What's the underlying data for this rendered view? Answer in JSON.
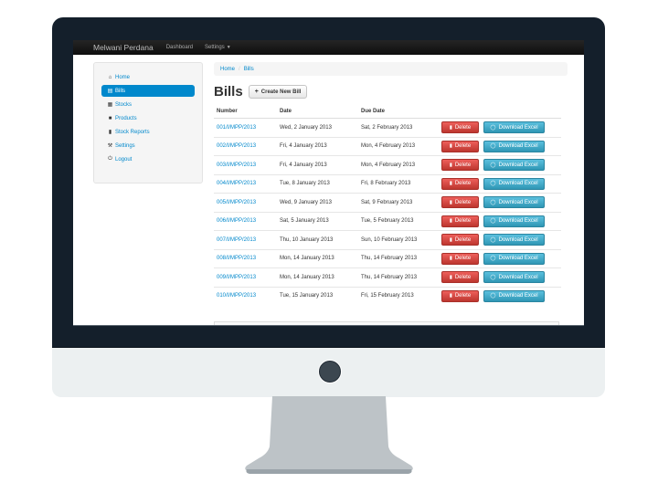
{
  "navbar": {
    "brand": "Melwani Perdana",
    "links": [
      {
        "label": "Dashboard"
      },
      {
        "label": "Settings",
        "has_caret": true
      }
    ]
  },
  "sidebar": {
    "items": [
      {
        "label": "Home",
        "icon": "home-icon",
        "glyph": "⌂",
        "active": false
      },
      {
        "label": "Bills",
        "icon": "list-icon",
        "glyph": "▤",
        "active": true
      },
      {
        "label": "Stocks",
        "icon": "grid-icon",
        "glyph": "▦",
        "active": false
      },
      {
        "label": "Products",
        "icon": "book-icon",
        "glyph": "■",
        "active": false
      },
      {
        "label": "Stock Reports",
        "icon": "file-icon",
        "glyph": "▮",
        "active": false
      },
      {
        "label": "Settings",
        "icon": "wrench-icon",
        "glyph": "⚒",
        "active": false
      },
      {
        "label": "Logout",
        "icon": "power-icon",
        "glyph": "⏻",
        "active": false
      }
    ]
  },
  "breadcrumb": {
    "home": "Home",
    "separator": "/",
    "current": "Bills"
  },
  "page": {
    "title": "Bills",
    "create_button": "Create New Bill",
    "create_glyph": "+"
  },
  "table": {
    "headers": [
      "Number",
      "Date",
      "Due Date",
      ""
    ],
    "delete_label": "Delete",
    "download_label": "Download Excel",
    "rows": [
      {
        "number": "001/I/MPP/2013",
        "date": "Wed, 2 January 2013",
        "due": "Sat, 2 February 2013"
      },
      {
        "number": "002/I/MPP/2013",
        "date": "Fri, 4 January 2013",
        "due": "Mon, 4 February 2013"
      },
      {
        "number": "003/I/MPP/2013",
        "date": "Fri, 4 January 2013",
        "due": "Mon, 4 February 2013"
      },
      {
        "number": "004/I/MPP/2013",
        "date": "Tue, 8 January 2013",
        "due": "Fri, 8 February 2013"
      },
      {
        "number": "005/I/MPP/2013",
        "date": "Wed, 9 January 2013",
        "due": "Sat, 9 February 2013"
      },
      {
        "number": "006/I/MPP/2013",
        "date": "Sat, 5 January 2013",
        "due": "Tue, 5 February 2013"
      },
      {
        "number": "007/I/MPP/2013",
        "date": "Thu, 10 January 2013",
        "due": "Sun, 10 February 2013"
      },
      {
        "number": "008/I/MPP/2013",
        "date": "Mon, 14 January 2013",
        "due": "Thu, 14 February 2013"
      },
      {
        "number": "009/I/MPP/2013",
        "date": "Mon, 14 January 2013",
        "due": "Thu, 14 February 2013"
      },
      {
        "number": "010/I/MPP/2013",
        "date": "Tue, 15 January 2013",
        "due": "Fri, 15 February 2013"
      }
    ]
  },
  "colors": {
    "bezel": "#141f2b",
    "chin": "#ecf0f1",
    "stand": "#bdc3c7",
    "link": "#0088cc",
    "danger": "#da4f49",
    "info": "#49afcd"
  }
}
